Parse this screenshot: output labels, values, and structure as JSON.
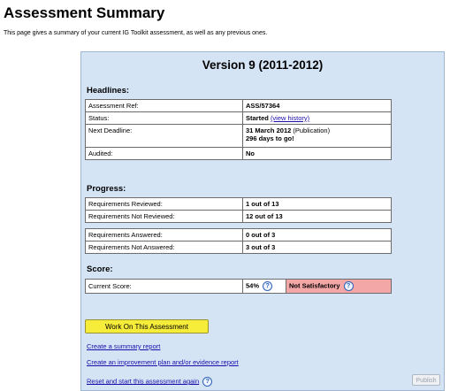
{
  "page": {
    "title": "Assessment Summary",
    "intro": "This page gives a summary of your current IG Toolkit assessment, as well as any previous ones."
  },
  "panel": {
    "version_title": "Version 9 (2011-2012)",
    "headlines": {
      "heading": "Headlines:",
      "assessment_ref_label": "Assessment Ref:",
      "assessment_ref_value": "ASS/57364",
      "status_label": "Status:",
      "status_value": "Started",
      "view_history_link": "(view history)",
      "next_deadline_label": "Next Deadline:",
      "next_deadline_value": "31 March 2012",
      "next_deadline_note": "(Publication)",
      "days_to_go": "296 days to go!",
      "audited_label": "Audited:",
      "audited_value": "No"
    },
    "progress": {
      "heading": "Progress:",
      "reviewed_label": "Requirements Reviewed:",
      "reviewed_value": "1 out of 13",
      "not_reviewed_label": "Requirements Not Reviewed:",
      "not_reviewed_value": "12 out of 13",
      "answered_label": "Requirements Answered:",
      "answered_value": "0 out of 3",
      "not_answered_label": "Requirements Not Answered:",
      "not_answered_value": "3 out of 3"
    },
    "score": {
      "heading": "Score:",
      "current_label": "Current Score:",
      "current_value": "54%",
      "rating": "Not Satisfactory",
      "rating_color": "#f4a7a7"
    },
    "actions": {
      "work_button": "Work On This Assessment",
      "summary_link": "Create a summary report",
      "improvement_link": "Create an improvement plan and/or evidence report",
      "reset_link": "Reset and start this assessment again",
      "publish_button": "Publish"
    }
  },
  "colors": {
    "panel_background": "#d5e4f5",
    "work_button": "#f6ec3a",
    "link": "#1a0dab"
  },
  "icons": [
    "help-icon"
  ]
}
